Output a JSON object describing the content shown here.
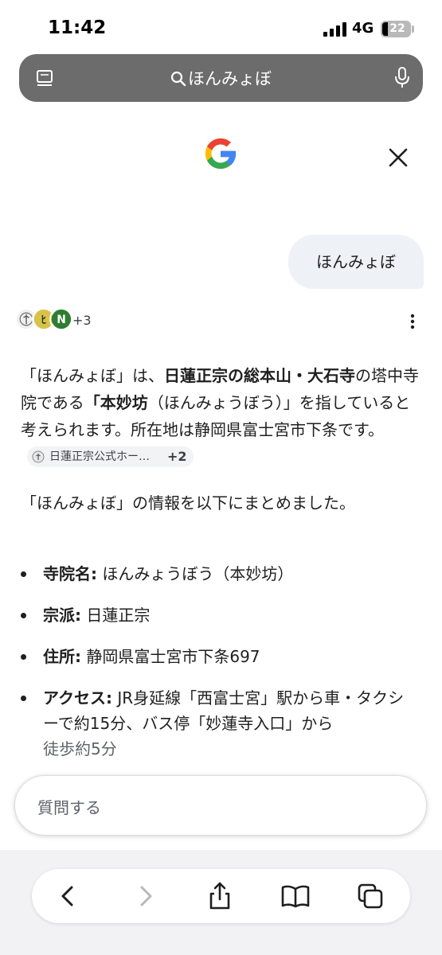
{
  "status_bar": {
    "time": "11:42",
    "network": "4G",
    "battery": "22"
  },
  "browser": {
    "url_text": "ほんみょぼ"
  },
  "query": "ほんみょぼ",
  "sources": {
    "more_count": "+3"
  },
  "answer": {
    "p1_prefix": "「ほんみょぼ」は、",
    "p1_bold1": "日蓮正宗の総本山・大石寺",
    "p1_mid": "の塔中寺院である",
    "p1_bold2": "「本妙坊",
    "p1_suffix": "（ほんみょうぼう）」を指していると考えられます。所在地は静岡県富士宮市下条です。",
    "citation_label": "日蓮正宗公式ホー…",
    "citation_more": "+2",
    "p2": "「ほんみょぼ」の情報を以下にまとめました。"
  },
  "details": [
    {
      "label": "寺院名:",
      "value": " ほんみょうぼう（本妙坊）"
    },
    {
      "label": "宗派:",
      "value": " 日蓮正宗"
    },
    {
      "label": "住所:",
      "value": " 静岡県富士宮市下条697"
    },
    {
      "label": "アクセス:",
      "value": " JR身延線「西富士宮」駅から車・タクシーで約15分、バス停「妙蓮寺入口」から",
      "value_faded": "徒歩約5分"
    }
  ],
  "ask": {
    "placeholder": "質問する"
  },
  "colors": {
    "google_blue": "#4285F4",
    "google_red": "#EA4335",
    "google_yellow": "#FBBC05",
    "google_green": "#34A853",
    "address_bar": "#6c6c6c",
    "bubble": "#eef1f5"
  },
  "icons": [
    "tabs-icon",
    "search-icon",
    "mic-icon",
    "google-logo",
    "close-icon",
    "more-vert-icon",
    "back-icon",
    "forward-icon",
    "share-icon",
    "bookmarks-icon",
    "tab-switcher-icon"
  ]
}
